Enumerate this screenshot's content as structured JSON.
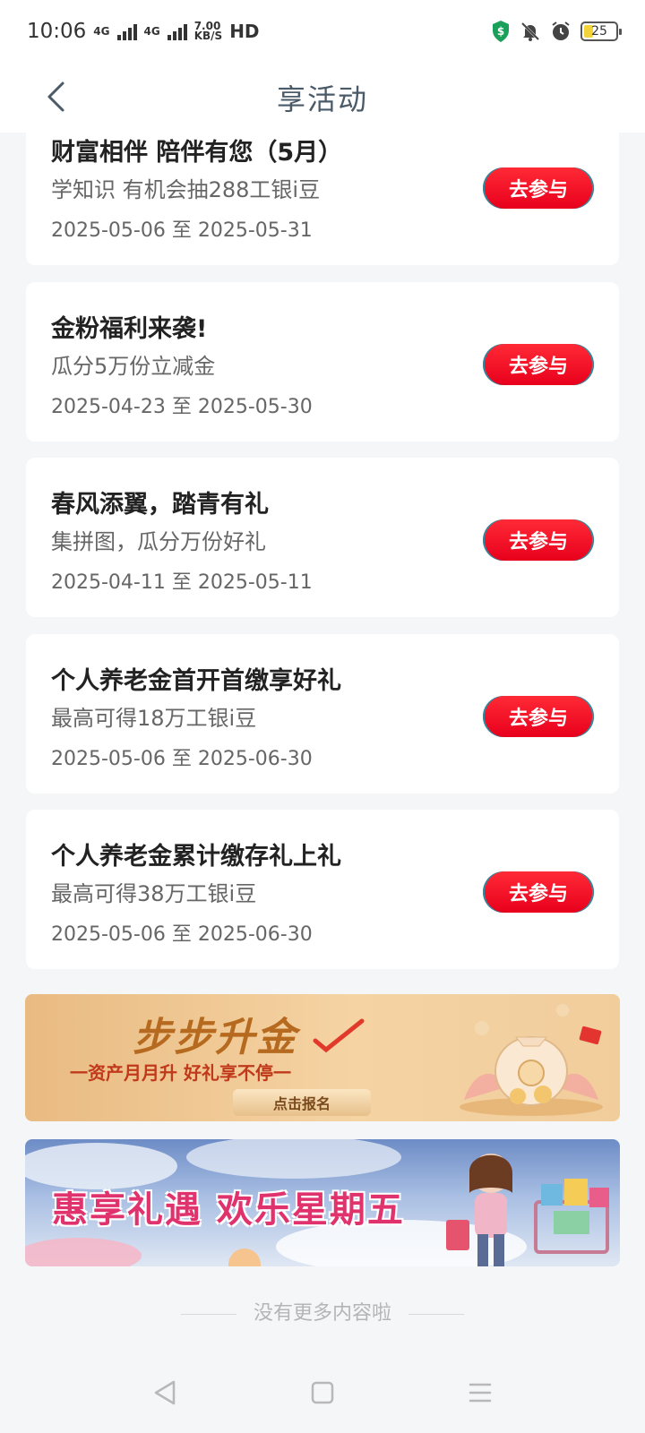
{
  "status_bar": {
    "time": "10:06",
    "network_1": "4G",
    "network_2": "4G",
    "speed_value": "7.00",
    "speed_unit": "KB/S",
    "hd_label": "HD",
    "battery": "25"
  },
  "header": {
    "title": "享活动"
  },
  "activities": [
    {
      "title": "财富相伴 陪伴有您（5月）",
      "subtitle": "学知识 有机会抽288工银i豆",
      "date_range": "2025-05-06 至 2025-05-31",
      "button": "去参与"
    },
    {
      "title": "金粉福利来袭!",
      "subtitle": "瓜分5万份立减金",
      "date_range": "2025-04-23 至 2025-05-30",
      "button": "去参与"
    },
    {
      "title": "春风添翼，踏青有礼",
      "subtitle": "集拼图，瓜分万份好礼",
      "date_range": "2025-04-11 至 2025-05-11",
      "button": "去参与"
    },
    {
      "title": "个人养老金首开首缴享好礼",
      "subtitle": "最高可得18万工银i豆",
      "date_range": "2025-05-06 至 2025-06-30",
      "button": "去参与"
    },
    {
      "title": "个人养老金累计缴存礼上礼",
      "subtitle": "最高可得38万工银i豆",
      "date_range": "2025-05-06 至 2025-06-30",
      "button": "去参与"
    }
  ],
  "banners": {
    "banner1": {
      "title": "步步升金",
      "subtitle": "一资产月月升  好礼享不停一",
      "button": "点击报名"
    },
    "banner2": {
      "title": "惠享礼遇 欢乐星期五"
    }
  },
  "footer_note": "没有更多内容啦",
  "colors": {
    "accent_red": "#e8001c",
    "title_gray": "#4a5a68",
    "background": "#f5f6f8"
  }
}
